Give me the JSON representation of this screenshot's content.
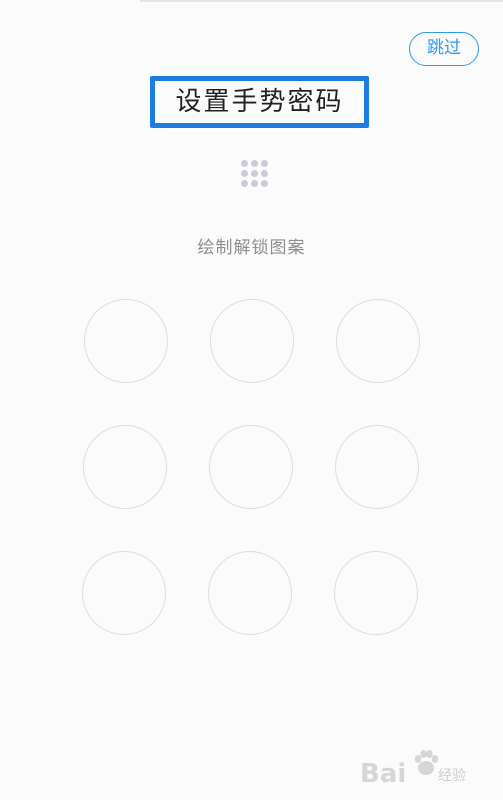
{
  "header": {
    "skip_label": "跳过",
    "title": "设置手势密码"
  },
  "pattern": {
    "hint": "绘制解锁图案",
    "rows": 3,
    "cols": 3
  },
  "watermark": {
    "text": "Bai",
    "sub": "经验",
    "logo_icon": "baidu-paw-icon"
  },
  "colors": {
    "accent": "#2b9ae8",
    "highlight_box": "#1e7be0",
    "circle_border": "#dedede",
    "mini_dot": "#c9cbd8",
    "hint_text": "#8f8f8f"
  }
}
